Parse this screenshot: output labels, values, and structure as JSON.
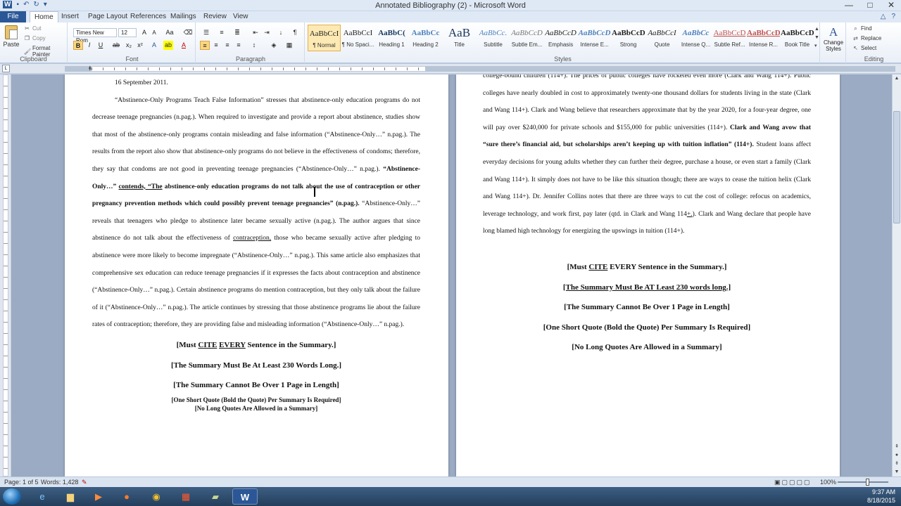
{
  "window": {
    "title": "Annotated Bibliography (2) - Microsoft Word",
    "controls": [
      "—",
      "□",
      "✕"
    ]
  },
  "tabs": [
    "File",
    "Home",
    "Insert",
    "Page Layout",
    "References",
    "Mailings",
    "Review",
    "View"
  ],
  "ribbon": {
    "clipboard": {
      "paste": "Paste",
      "cut": "Cut",
      "copy": "Copy",
      "format_painter": "Format Painter",
      "label": "Clipboard"
    },
    "font": {
      "name": "Times New Rom",
      "size": "12",
      "label": "Font"
    },
    "paragraph": {
      "label": "Paragraph"
    },
    "styles": {
      "label": "Styles",
      "items": [
        {
          "sample": "AaBbCcI",
          "name": "¶ Normal"
        },
        {
          "sample": "AaBbCcI",
          "name": "¶ No Spaci..."
        },
        {
          "sample": "AaBbC(",
          "name": "Heading 1"
        },
        {
          "sample": "AaBbCc",
          "name": "Heading 2"
        },
        {
          "sample": "AaB",
          "name": "Title"
        },
        {
          "sample": "AaBbCc.",
          "name": "Subtitle"
        },
        {
          "sample": "AaBbCcD",
          "name": "Subtle Em..."
        },
        {
          "sample": "AaBbCcD",
          "name": "Emphasis"
        },
        {
          "sample": "AaBbCcD",
          "name": "Intense E..."
        },
        {
          "sample": "AaBbCcD",
          "name": "Strong"
        },
        {
          "sample": "AaBbCcI",
          "name": "Quote"
        },
        {
          "sample": "AaBbCc",
          "name": "Intense Q..."
        },
        {
          "sample": "AaBbCcD",
          "name": "Subtle Ref..."
        },
        {
          "sample": "AaBbCcD",
          "name": "Intense R..."
        },
        {
          "sample": "AaBbCcD",
          "name": "Book Title"
        }
      ],
      "change": "Change Styles"
    },
    "editing": {
      "find": "Find",
      "replace": "Replace",
      "select": "Select",
      "label": "Editing"
    }
  },
  "page1": {
    "date_line": "16 September 2011.",
    "para_seg1": "“Abstinence-Only Programs Teach False Information” stresses that abstinence-only education programs do not decrease teenage pregnancies (",
    "npag": "n.pag.",
    "para_seg2": "). When required to investigate and provide a report about abstinence, studies show that most of the abstinence-only programs contain misleading and false information (“Abstinence-Only…” ",
    "para_seg3": "). The results from the report also show that abstinence-only programs do not believe in the effectiveness of condoms; therefore, they say that condoms are not good in preventing teenage pregnancies (“Abstinence-Only…” ",
    "para_seg4": "). ",
    "bold_seg1": "“Abstinence-Only…” ",
    "bold_u_seg": "contends, “The",
    "bold_seg2": " abstinence-only education programs do not talk about the use of contraception or other pregnancy prevention methods which could possibly prevent teenage pregnancies” (",
    "bold_seg3": ").",
    "para_seg5": " “Abstinence-Only…” reveals that teenagers who pledge to abstinence later became sexually active (",
    "para_seg6": "). The author argues that since abstinence do not talk about the effectiveness of ",
    "contraception": "contraception,",
    "para_seg7": " those who became sexually active after pledging to abstinence were more likely to become impregnate (“Abstinence-Only…” ",
    "para_seg8": "). This same article also emphasizes that comprehensive sex education can reduce teenage pregnancies if it expresses the facts about contraception and abstinence (“Abstinence-Only…” ",
    "para_seg9": "). Certain abstinence programs do mention contraception, but they only talk about the failure of it (“Abstinence-Only…” ",
    "para_seg10": "). The article continues by stressing that those abstinence programs lie about the failure rates of contraception; therefore, they are providing false and misleading information (“Abstinence-Only…” ",
    "para_seg11": ").",
    "req": {
      "cite_pre": "[Must ",
      "cite_u1": "CITE",
      "cite_sp": " ",
      "cite_u2": "EVERY",
      "cite_post": " Sentence in the Summary.]",
      "min_words": "[The Summary Must Be At Least 230 Words Long.]",
      "max_page": "[The Summary Cannot Be Over 1 Page in Length]",
      "short_quote": "[One Short Quote (Bold the Quote) Per Summary Is Required]",
      "no_long": "[No Long Quotes Are Allowed in a Summary]"
    }
  },
  "page2": {
    "seg1": "college-bound children (114+).  The prices of public colleges have rocketed even more (Clark and Wang 114+).  Public colleges have nearly doubled in cost to approximately twenty-one thousand dollars for students living in the state (Clark and Wang 114+).  Clark and Wang believe that researchers approximate that by the year 2020, for a four-year degree, one will pay over $240,000 for private schools and $155,000 for public universities (114+).  ",
    "bold1": "Clark and Wang avow that “sure there’s financial aid, but scholarships aren’t keeping up with tuition inflation” (114+).",
    "seg2": "  Student loans affect everyday decisions for young adults whether they can further their degree, purchase a house, or even start a family (Clark and Wang 114+).  It simply does not have to be like this situation though; there are ways to cease the tuition helix (Clark and Wang 114+).  Dr. Jennifer Collins notes that there are three ways to cut the cost of college: refocus on academics, leverage technology, and work first, pay later (",
    "qtd": "qtd.",
    "seg3": " in Clark and Wang 114",
    "plus": "+.",
    "seg4": ").  Clark and Wang declare that people have long blamed high technology for energizing the upswings in tuition (114+).",
    "req": {
      "cite_pre": "[Must ",
      "cite_u1": "CITE",
      "cite_u2": "EVERY",
      "cite_post": " Sentence in the Summary.]",
      "min_words": "[The Summary Must Be AT Least 230 words long.]",
      "max_page": "[The Summary Cannot Be Over 1 Page in Length]",
      "short_quote": "[One Short Quote (Bold the Quote) Per Summary Is Required]",
      "no_long": "[No Long Quotes Are Allowed in a Summary]"
    }
  },
  "status": {
    "page": "Page: 1 of 5",
    "words": "Words: 1,428",
    "zoom": "100%"
  },
  "tray": {
    "time": "9:37 AM",
    "date": "8/18/2015"
  }
}
